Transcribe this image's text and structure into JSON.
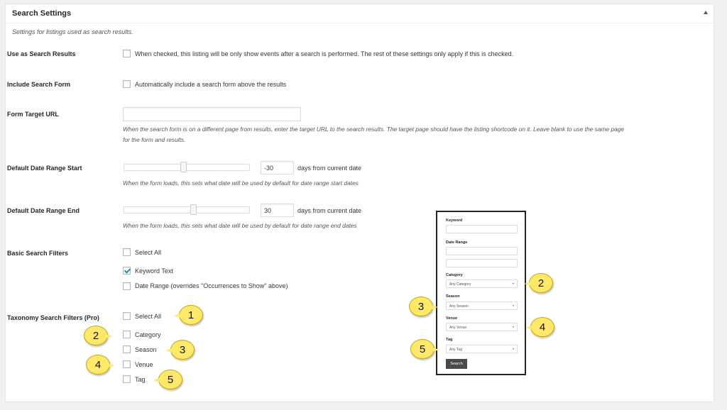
{
  "panel": {
    "title": "Search Settings",
    "description": "Settings for listings used as search results."
  },
  "rows": {
    "use_search": {
      "label": "Use as Search Results",
      "text": "When checked, this listing will be only show events after a search is performed. The rest of these settings only apply if this is checked."
    },
    "include_form": {
      "label": "Include Search Form",
      "text": "Automatically include a search form above the results"
    },
    "target_url": {
      "label": "Form Target URL",
      "value": "",
      "help_line1": "When the search form is on a different page from results, enter the target URL to the search results. The target page should have the listing shortcode on it. Leave blank to use the same page",
      "help_line2": "for the form and results."
    },
    "range_start": {
      "label": "Default Date Range Start",
      "value": "-30",
      "suffix": "days from current date",
      "help": "When the form loads, this sets what date will be used by default for date range start dates",
      "slider_fraction": 0.47
    },
    "range_end": {
      "label": "Default Date Range End",
      "value": "30",
      "suffix": "days from current date",
      "help": "When the form loads, this sets what date will be used by default for date range end dates",
      "slider_fraction": 0.55
    },
    "basic_filters": {
      "label": "Basic Search Filters",
      "options": [
        "Select All",
        "Keyword Text",
        "Date Range (overrides \"Occurrences to Show\" above)"
      ],
      "checked": [
        false,
        true,
        false
      ]
    },
    "taxonomy_filters": {
      "label": "Taxonomy Search Filters (Pro)",
      "options": [
        "Select All",
        "Category",
        "Season",
        "Venue",
        "Tag"
      ]
    }
  },
  "preview": {
    "keyword_label": "Keyword",
    "date_range_label": "Date Range",
    "category_label": "Category",
    "category_value": "Any Category",
    "season_label": "Season",
    "season_value": "Any Season",
    "venue_label": "Venue",
    "venue_value": "Any Venue",
    "tag_label": "Tag",
    "tag_value": "Any Tag",
    "button_label": "Search"
  },
  "callouts": [
    "1",
    "2",
    "3",
    "4",
    "5"
  ],
  "colors": {
    "callout": "#ffe86a",
    "check": "#1e8cbe",
    "button": "#4a4a4a"
  }
}
